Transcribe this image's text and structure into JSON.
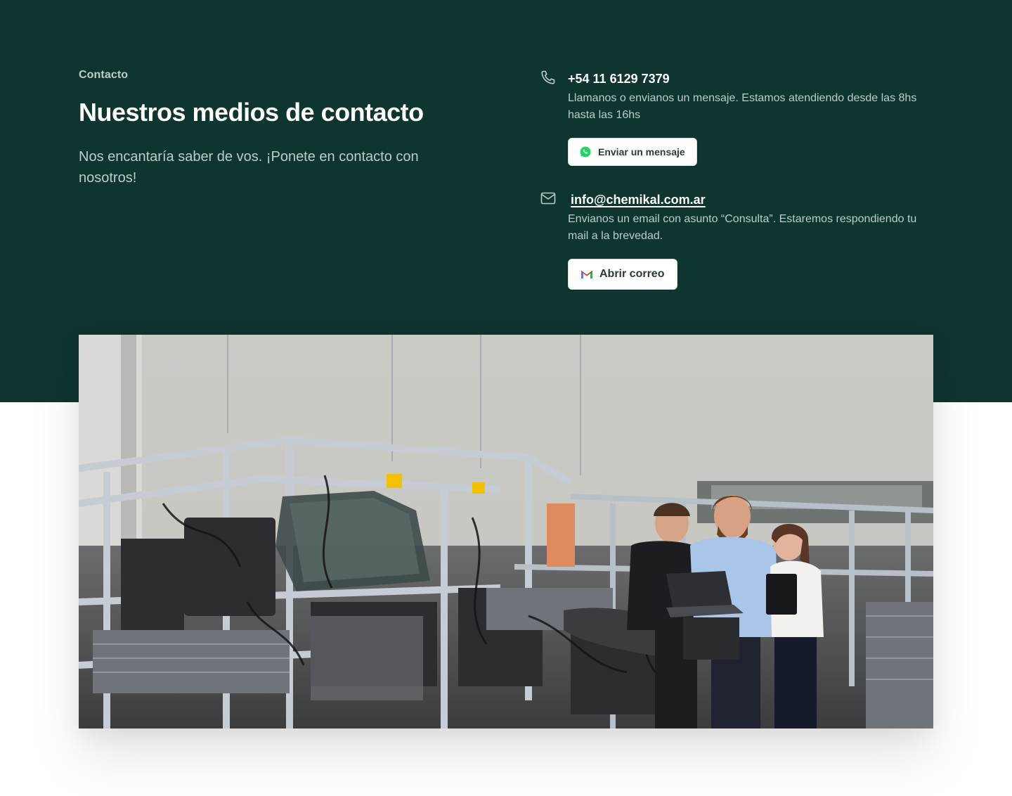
{
  "section": {
    "eyebrow": "Contacto",
    "title": "Nuestros medios de contacto",
    "intro": "Nos encantaría saber de vos. ¡Ponete en contacto con nosotros!"
  },
  "phone": {
    "icon": "phone-icon",
    "number": "+54 11 6129 7379",
    "description": "Llamanos o envianos un mensaje. Estamos atendiendo desde las 8hs hasta las 16hs",
    "button_icon": "whatsapp-icon",
    "button_label": "Enviar un mensaje"
  },
  "email": {
    "icon": "mail-icon",
    "address": "info@chemikal.com.ar",
    "description": "Envianos un email con asunto “Consulta”. Estaremos respondiendo tu mail a la brevedad.",
    "button_icon": "gmail-icon",
    "button_label": "Abrir correo"
  },
  "image": {
    "alt": "Equipo de ingenieros trabajando en una planta con bancos de prueba automotrices"
  },
  "colors": {
    "hero_background": "#0f3530",
    "muted_text": "#b7cfc8",
    "heading_text": "#ffffff",
    "button_background": "#ffffff",
    "whatsapp_green": "#25d366"
  }
}
